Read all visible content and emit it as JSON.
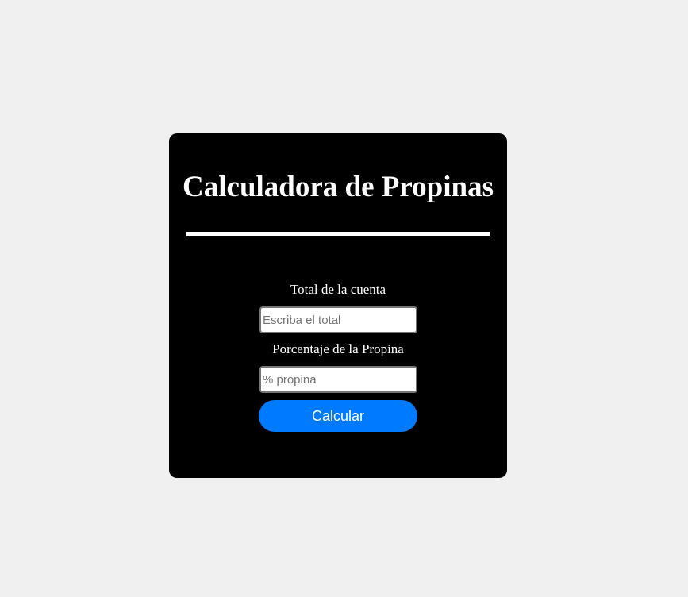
{
  "app": {
    "title": "Calculadora de Propinas"
  },
  "form": {
    "total_label": "Total de la cuenta",
    "total_placeholder": "Escriba el total",
    "total_value": "",
    "tip_label": "Porcentaje de la Propina",
    "tip_placeholder": "% propina",
    "tip_value": "",
    "calculate_label": "Calcular"
  },
  "colors": {
    "page_background": "#f0f0f0",
    "card_background": "#000000",
    "text": "#ffffff",
    "button": "#007bff"
  }
}
